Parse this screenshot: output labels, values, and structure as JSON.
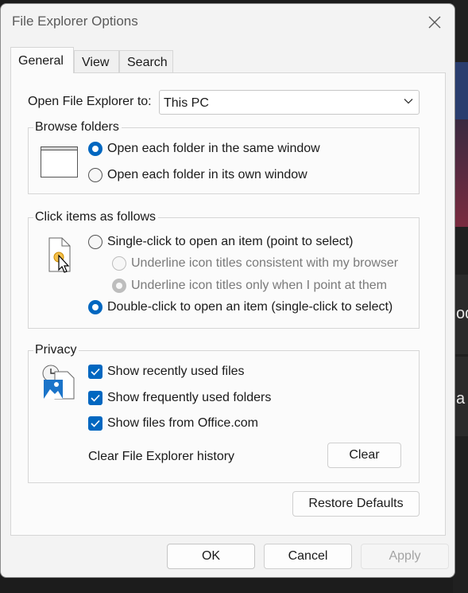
{
  "window": {
    "title": "File Explorer Options"
  },
  "tabs": [
    {
      "label": "General",
      "active": true
    },
    {
      "label": "View"
    },
    {
      "label": "Search"
    }
  ],
  "open_to": {
    "label": "Open File Explorer to:",
    "value": "This PC"
  },
  "browse_folders": {
    "title": "Browse folders",
    "options": [
      {
        "label": "Open each folder in the same window",
        "checked": true
      },
      {
        "label": "Open each folder in its own window",
        "checked": false
      }
    ]
  },
  "click_items": {
    "title": "Click items as follows",
    "single_click": "Single-click to open an item (point to select)",
    "underline_browser": "Underline icon titles consistent with my browser",
    "underline_point": "Underline icon titles only when I point at them",
    "double_click": "Double-click to open an item (single-click to select)"
  },
  "privacy": {
    "title": "Privacy",
    "checks": [
      {
        "label": "Show recently used files",
        "checked": true
      },
      {
        "label": "Show frequently used folders",
        "checked": true
      },
      {
        "label": "Show files from Office.com",
        "checked": true
      }
    ],
    "clear_history_label": "Clear File Explorer history",
    "clear_button": "Clear"
  },
  "restore_defaults": "Restore Defaults",
  "footer": {
    "ok": "OK",
    "cancel": "Cancel",
    "apply": "Apply"
  },
  "background_text": {
    "line1": "od",
    "line2": "a"
  },
  "colors": {
    "accent": "#0067c0",
    "dialog_bg": "#f3f3f3",
    "panel_bg": "#fbfbfb"
  }
}
